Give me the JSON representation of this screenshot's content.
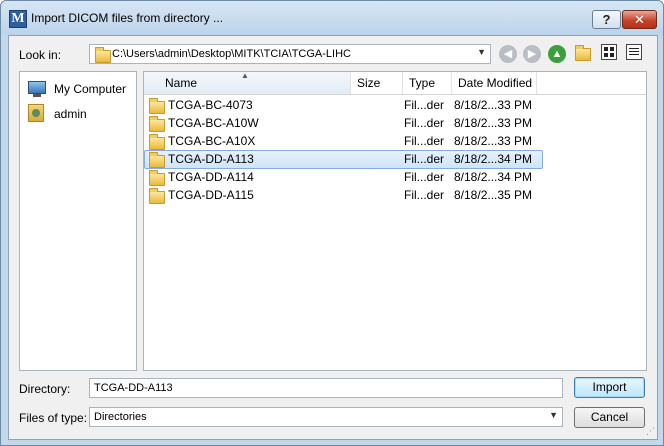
{
  "window": {
    "title": "Import DICOM files from directory ...",
    "app_icon": "M",
    "help_label": "?",
    "close_label": "✕"
  },
  "lookin": {
    "label": "Look in:",
    "path": "C:\\Users\\admin\\Desktop\\MITK\\TCIA\\TCGA-LIHC"
  },
  "nav_icons": [
    "back-icon",
    "forward-icon",
    "up-icon",
    "new-folder-icon",
    "detail-view-icon",
    "list-view-icon"
  ],
  "sidebar": {
    "items": [
      {
        "label": "My Computer",
        "icon": "computer-icon"
      },
      {
        "label": "admin",
        "icon": "user-folder-icon"
      }
    ]
  },
  "columns": [
    "Name",
    "Size",
    "Type",
    "Date Modified"
  ],
  "files": [
    {
      "name": "TCGA-BC-4073",
      "size": "",
      "type": "Fil...der",
      "date": "8/18/2...33 PM"
    },
    {
      "name": "TCGA-BC-A10W",
      "size": "",
      "type": "Fil...der",
      "date": "8/18/2...33 PM"
    },
    {
      "name": "TCGA-BC-A10X",
      "size": "",
      "type": "Fil...der",
      "date": "8/18/2...33 PM"
    },
    {
      "name": "TCGA-DD-A113",
      "size": "",
      "type": "Fil...der",
      "date": "8/18/2...34 PM"
    },
    {
      "name": "TCGA-DD-A114",
      "size": "",
      "type": "Fil...der",
      "date": "8/18/2...34 PM"
    },
    {
      "name": "TCGA-DD-A115",
      "size": "",
      "type": "Fil...der",
      "date": "8/18/2...35 PM"
    }
  ],
  "selected_row": 3,
  "directory": {
    "label": "Directory:",
    "value": "TCGA-DD-A113"
  },
  "file_type": {
    "label": "Files of type:",
    "value": "Directories"
  },
  "buttons": {
    "import": "Import",
    "cancel": "Cancel"
  }
}
